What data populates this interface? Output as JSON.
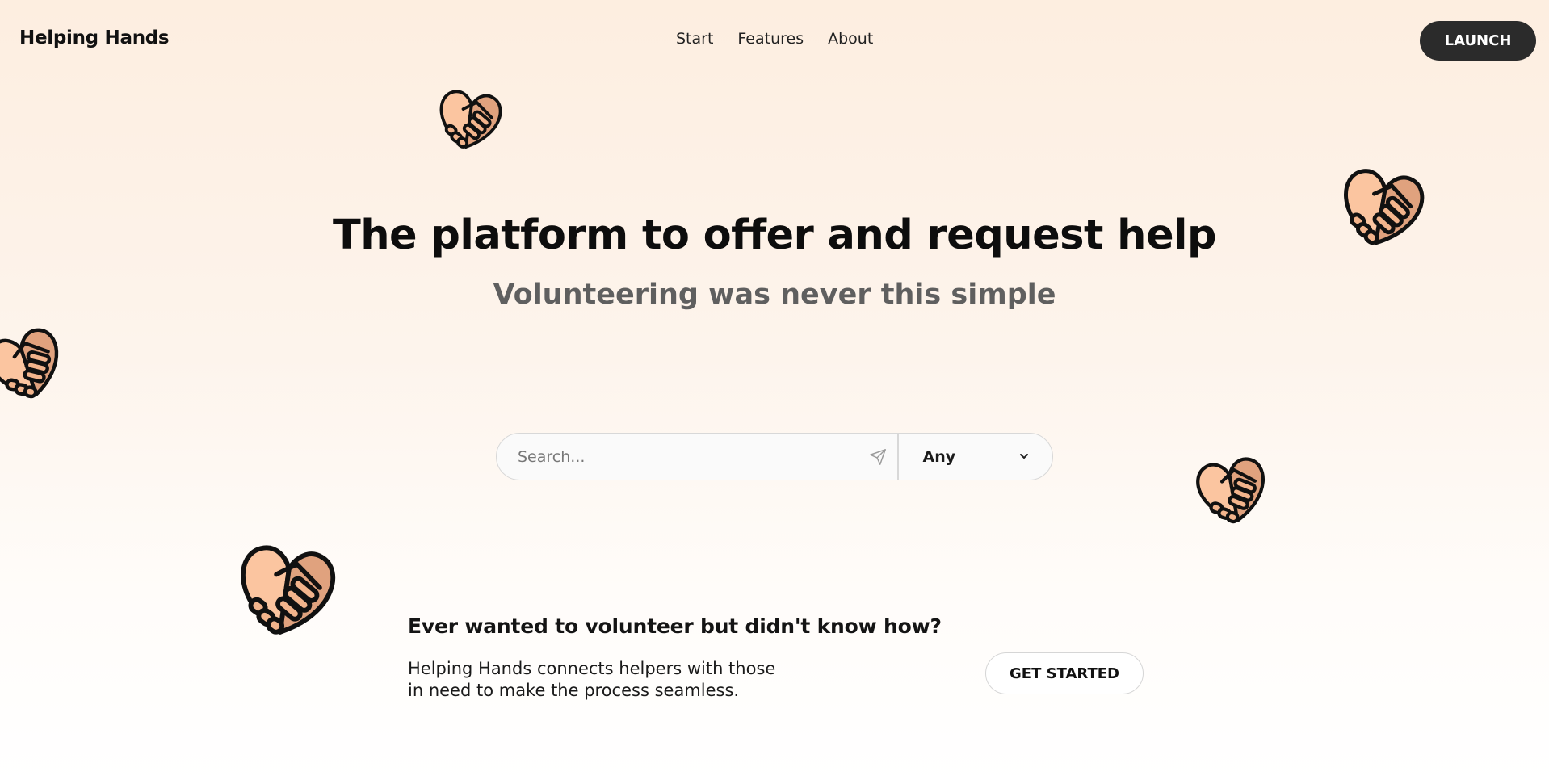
{
  "header": {
    "brand": "Helping Hands",
    "nav": [
      "Start",
      "Features",
      "About"
    ],
    "launch_label": "LAUNCH"
  },
  "hero": {
    "title": "The platform to offer and request help",
    "subtitle": "Volunteering was never this simple"
  },
  "search": {
    "placeholder": "Search...",
    "value": "",
    "filter_selected": "Any",
    "send_icon": "paper-plane-icon",
    "dropdown_icon": "chevron-down-icon"
  },
  "cta": {
    "heading": "Ever wanted to volunteer but didn't know how?",
    "body_line1": "Helping Hands connects helpers with those",
    "body_line2": "in need to make the process seamless.",
    "button_label": "GET STARTED"
  },
  "decorations": {
    "icon": "heart-handshake-icon",
    "colors": {
      "light_hand": "#fbc5a0",
      "dark_hand": "#e0a27e",
      "outline": "#111111"
    }
  },
  "colors": {
    "background_top": "#fdeee0",
    "background_bottom": "#ffffff",
    "launch_button": "#2b2b2b",
    "subtitle": "#5f5f5f"
  }
}
